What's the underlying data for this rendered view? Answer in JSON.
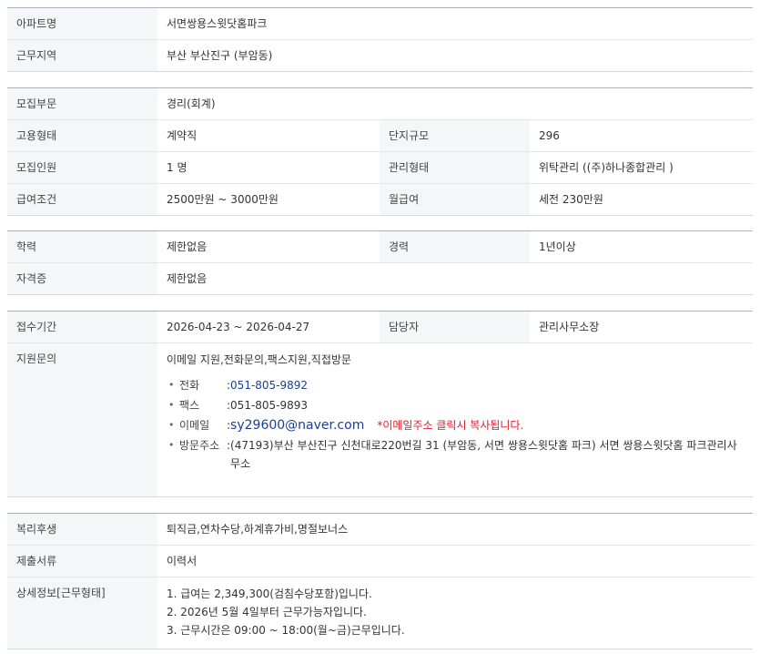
{
  "apartment": {
    "name_label": "아파트명",
    "name_value": "서면쌍용스윗닷홈파크",
    "region_label": "근무지역",
    "region_value": "부산  부산진구 (부암동)"
  },
  "recruit": {
    "dept_label": "모집부문",
    "dept_value": "경리(회계)",
    "employment_label": "고용형태",
    "employment_value": "계약직",
    "complex_label": "단지규모",
    "complex_value": "296",
    "count_label": "모집인원",
    "count_value": "1 명",
    "mgmt_label": "관리형태",
    "mgmt_value": "위탁관리 ((주)하나종합관리 )",
    "salary_label": "급여조건",
    "salary_value": "2500만원 ~ 3000만원",
    "monthly_label": "월급여",
    "monthly_value": "세전 230만원"
  },
  "qualification": {
    "edu_label": "학력",
    "edu_value": "제한없음",
    "career_label": "경력",
    "career_value": "1년이상",
    "license_label": "자격증",
    "license_value": "제한없음"
  },
  "apply": {
    "period_label": "접수기간",
    "period_value": "2026-04-23 ~ 2026-04-27",
    "manager_label": "담당자",
    "manager_value": "관리사무소장",
    "inquiry_label": "지원문의",
    "inquiry_methods": "이메일 지원,전화문의,팩스지원,직접방문",
    "phone_label": "전화",
    "phone_value": "051-805-9892",
    "fax_label": "팩스",
    "fax_value": "051-805-9893",
    "email_label": "이메일",
    "email_value": "sy29600@naver.com",
    "email_note": "*이메일주소 클릭시 복사됩니다.",
    "visit_label": "방문주소",
    "visit_value": "(47193)부산 부산진구 신천대로220번길 31 (부암동, 서면 쌍용스윗닷홈 파크) 서면 쌍용스윗닷홈 파크관리사무소",
    "colon": ":"
  },
  "etc": {
    "welfare_label": "복리후생",
    "welfare_value": "퇴직금,연차수당,하계휴가비,명절보너스",
    "docs_label": "제출서류",
    "docs_value": "이력서",
    "detail_label": "상세정보[근무형태]",
    "detail_lines": [
      "1. 급여는 2,349,300(검침수당포함)입니다.",
      "2. 2026년 5월 4일부터 근무가능자입니다.",
      "3. 근무시간은 09:00 ~ 18:00(월~금)근무입니다."
    ]
  },
  "colors": {
    "border_top": "#a9b0bb",
    "header_bg": "#f5f6f8",
    "link": "#1c3f8f",
    "note": "#e0202a"
  }
}
